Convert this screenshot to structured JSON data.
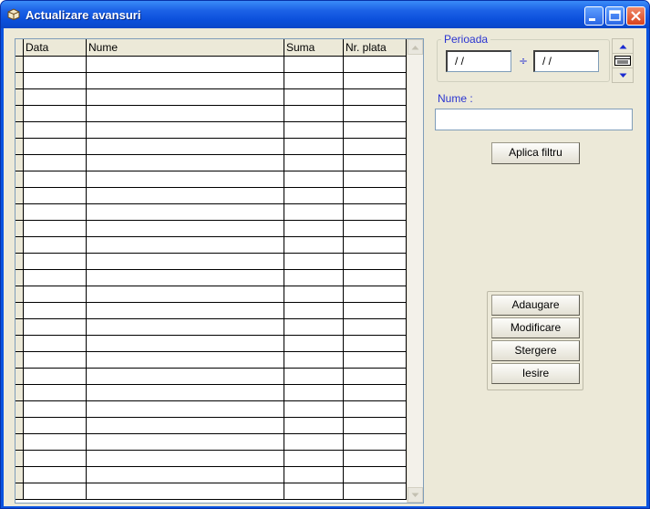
{
  "window": {
    "title": "Actualizare avansuri",
    "accent": "#0a53e0"
  },
  "grid": {
    "columns": [
      "Data",
      "Nume",
      "Suma",
      "Nr. plata"
    ],
    "row_count": 27
  },
  "filter": {
    "period_label": "Perioada",
    "date_from": " / /",
    "date_separator": "÷",
    "date_to": " / /",
    "name_label": "Nume :",
    "name_value": "",
    "apply_label": "Aplica filtru"
  },
  "actions": {
    "add_label": "Adaugare",
    "edit_label": "Modificare",
    "delete_label": "Stergere",
    "exit_label": "Iesire"
  },
  "icons": {
    "title": "app-box-icon",
    "minimize": "minimize-icon",
    "maximize": "maximize-icon",
    "close": "close-icon",
    "spin_up": "arrow-up-icon",
    "spin_down": "arrow-down-icon",
    "calendar": "calendar-icon"
  }
}
